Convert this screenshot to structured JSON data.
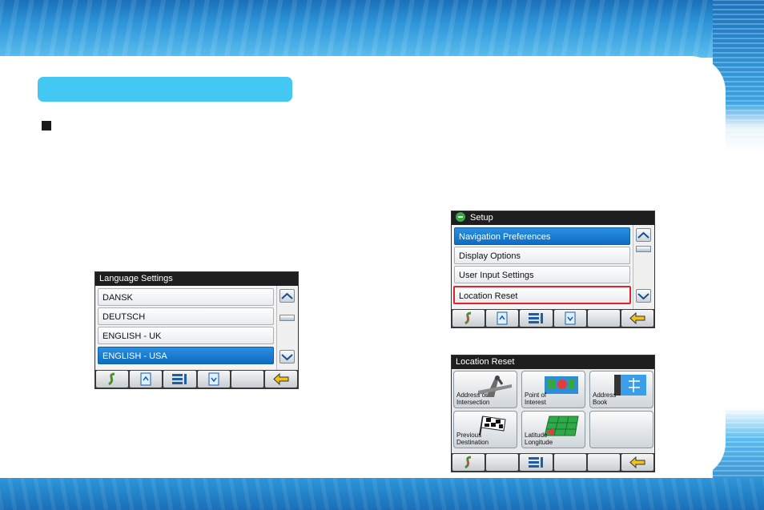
{
  "language_screen": {
    "title": "Language Settings",
    "items": [
      {
        "label": "DANSK"
      },
      {
        "label": "DEUTSCH"
      },
      {
        "label": "ENGLISH - UK"
      },
      {
        "label": "ENGLISH - USA"
      }
    ],
    "selected_index": 3
  },
  "setup_screen": {
    "title": "Setup",
    "items": [
      {
        "label": "Navigation Preferences"
      },
      {
        "label": "Display Options"
      },
      {
        "label": "User Input Settings"
      },
      {
        "label": "Location Reset"
      }
    ],
    "selected_index": 0,
    "highlighted_index": 3
  },
  "location_reset_screen": {
    "title": "Location Reset",
    "tiles": [
      {
        "line1": "Address or",
        "line2": "Intersection"
      },
      {
        "line1": "Point of",
        "line2": "Interest"
      },
      {
        "line1": "Address",
        "line2": "Book"
      },
      {
        "line1": "Previous",
        "line2": "Destination"
      },
      {
        "line1": "Latitude",
        "line2": "Longitude"
      },
      {
        "line1": "",
        "line2": ""
      }
    ]
  },
  "colors": {
    "section_bar": "#43c8f4",
    "selected_row": "#1570c8",
    "highlight_outline": "#e0242c",
    "band_blue": "#2e95d8"
  }
}
